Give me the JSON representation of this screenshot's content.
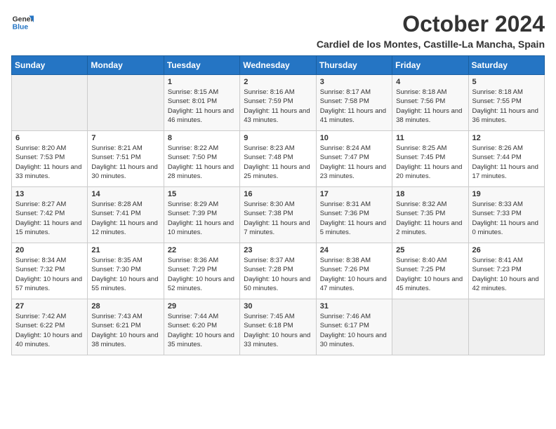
{
  "logo": {
    "line1": "General",
    "line2": "Blue"
  },
  "title": "October 2024",
  "location": "Cardiel de los Montes, Castille-La Mancha, Spain",
  "days_of_week": [
    "Sunday",
    "Monday",
    "Tuesday",
    "Wednesday",
    "Thursday",
    "Friday",
    "Saturday"
  ],
  "weeks": [
    [
      {
        "day": "",
        "info": ""
      },
      {
        "day": "",
        "info": ""
      },
      {
        "day": "1",
        "info": "Sunrise: 8:15 AM\nSunset: 8:01 PM\nDaylight: 11 hours and 46 minutes."
      },
      {
        "day": "2",
        "info": "Sunrise: 8:16 AM\nSunset: 7:59 PM\nDaylight: 11 hours and 43 minutes."
      },
      {
        "day": "3",
        "info": "Sunrise: 8:17 AM\nSunset: 7:58 PM\nDaylight: 11 hours and 41 minutes."
      },
      {
        "day": "4",
        "info": "Sunrise: 8:18 AM\nSunset: 7:56 PM\nDaylight: 11 hours and 38 minutes."
      },
      {
        "day": "5",
        "info": "Sunrise: 8:18 AM\nSunset: 7:55 PM\nDaylight: 11 hours and 36 minutes."
      }
    ],
    [
      {
        "day": "6",
        "info": "Sunrise: 8:20 AM\nSunset: 7:53 PM\nDaylight: 11 hours and 33 minutes."
      },
      {
        "day": "7",
        "info": "Sunrise: 8:21 AM\nSunset: 7:51 PM\nDaylight: 11 hours and 30 minutes."
      },
      {
        "day": "8",
        "info": "Sunrise: 8:22 AM\nSunset: 7:50 PM\nDaylight: 11 hours and 28 minutes."
      },
      {
        "day": "9",
        "info": "Sunrise: 8:23 AM\nSunset: 7:48 PM\nDaylight: 11 hours and 25 minutes."
      },
      {
        "day": "10",
        "info": "Sunrise: 8:24 AM\nSunset: 7:47 PM\nDaylight: 11 hours and 23 minutes."
      },
      {
        "day": "11",
        "info": "Sunrise: 8:25 AM\nSunset: 7:45 PM\nDaylight: 11 hours and 20 minutes."
      },
      {
        "day": "12",
        "info": "Sunrise: 8:26 AM\nSunset: 7:44 PM\nDaylight: 11 hours and 17 minutes."
      }
    ],
    [
      {
        "day": "13",
        "info": "Sunrise: 8:27 AM\nSunset: 7:42 PM\nDaylight: 11 hours and 15 minutes."
      },
      {
        "day": "14",
        "info": "Sunrise: 8:28 AM\nSunset: 7:41 PM\nDaylight: 11 hours and 12 minutes."
      },
      {
        "day": "15",
        "info": "Sunrise: 8:29 AM\nSunset: 7:39 PM\nDaylight: 11 hours and 10 minutes."
      },
      {
        "day": "16",
        "info": "Sunrise: 8:30 AM\nSunset: 7:38 PM\nDaylight: 11 hours and 7 minutes."
      },
      {
        "day": "17",
        "info": "Sunrise: 8:31 AM\nSunset: 7:36 PM\nDaylight: 11 hours and 5 minutes."
      },
      {
        "day": "18",
        "info": "Sunrise: 8:32 AM\nSunset: 7:35 PM\nDaylight: 11 hours and 2 minutes."
      },
      {
        "day": "19",
        "info": "Sunrise: 8:33 AM\nSunset: 7:33 PM\nDaylight: 11 hours and 0 minutes."
      }
    ],
    [
      {
        "day": "20",
        "info": "Sunrise: 8:34 AM\nSunset: 7:32 PM\nDaylight: 10 hours and 57 minutes."
      },
      {
        "day": "21",
        "info": "Sunrise: 8:35 AM\nSunset: 7:30 PM\nDaylight: 10 hours and 55 minutes."
      },
      {
        "day": "22",
        "info": "Sunrise: 8:36 AM\nSunset: 7:29 PM\nDaylight: 10 hours and 52 minutes."
      },
      {
        "day": "23",
        "info": "Sunrise: 8:37 AM\nSunset: 7:28 PM\nDaylight: 10 hours and 50 minutes."
      },
      {
        "day": "24",
        "info": "Sunrise: 8:38 AM\nSunset: 7:26 PM\nDaylight: 10 hours and 47 minutes."
      },
      {
        "day": "25",
        "info": "Sunrise: 8:40 AM\nSunset: 7:25 PM\nDaylight: 10 hours and 45 minutes."
      },
      {
        "day": "26",
        "info": "Sunrise: 8:41 AM\nSunset: 7:23 PM\nDaylight: 10 hours and 42 minutes."
      }
    ],
    [
      {
        "day": "27",
        "info": "Sunrise: 7:42 AM\nSunset: 6:22 PM\nDaylight: 10 hours and 40 minutes."
      },
      {
        "day": "28",
        "info": "Sunrise: 7:43 AM\nSunset: 6:21 PM\nDaylight: 10 hours and 38 minutes."
      },
      {
        "day": "29",
        "info": "Sunrise: 7:44 AM\nSunset: 6:20 PM\nDaylight: 10 hours and 35 minutes."
      },
      {
        "day": "30",
        "info": "Sunrise: 7:45 AM\nSunset: 6:18 PM\nDaylight: 10 hours and 33 minutes."
      },
      {
        "day": "31",
        "info": "Sunrise: 7:46 AM\nSunset: 6:17 PM\nDaylight: 10 hours and 30 minutes."
      },
      {
        "day": "",
        "info": ""
      },
      {
        "day": "",
        "info": ""
      }
    ]
  ]
}
